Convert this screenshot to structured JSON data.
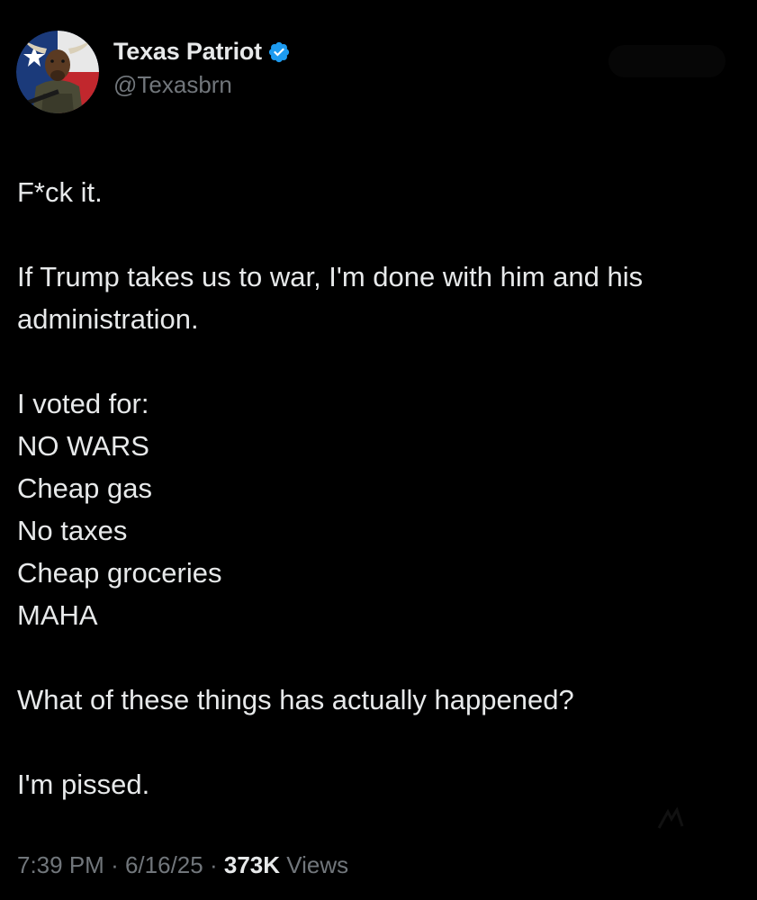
{
  "author": {
    "display_name": "Texas Patriot",
    "handle": "@Texasbrn",
    "verified_icon": "verified-badge-icon",
    "verified_color": "#1d9bf0"
  },
  "post": {
    "lines": [
      "F*ck it.",
      "",
      "If Trump takes us to war, I'm done with him and his administration.",
      "",
      "I voted for:",
      "NO WARS",
      "Cheap gas",
      "No taxes",
      "Cheap groceries",
      "MAHA",
      "",
      "What of these things has actually happened?",
      "",
      "I'm pissed."
    ]
  },
  "meta": {
    "time": "7:39 PM",
    "separator": "·",
    "date": "6/16/25",
    "views_count": "373K",
    "views_label": "Views"
  },
  "colors": {
    "background": "#000000",
    "text_primary": "#e7e9ea",
    "text_secondary": "#71767b"
  }
}
